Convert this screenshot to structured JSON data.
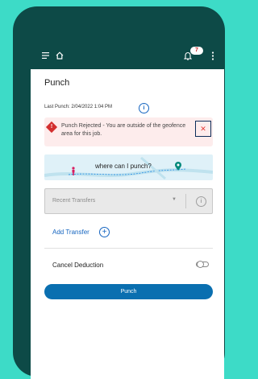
{
  "colors": {
    "background": "#3ddbc7",
    "device": "#0d4a47",
    "primary": "#0a6fb0",
    "link": "#1565c0",
    "alert_bg": "#fdecec",
    "alert_icon": "#d32f2f"
  },
  "header": {
    "menu_icon": "hamburger-menu-icon",
    "home_icon": "home-icon",
    "notification_icon": "bell-icon",
    "notification_count": "7",
    "more_icon": "kebab-menu-icon"
  },
  "page": {
    "title": "Punch",
    "last_punch": "Last Punch: 2/04/2022 1:04 PM",
    "last_punch_info_icon": "info-icon"
  },
  "alert": {
    "icon": "warning-diamond-icon",
    "message": "Punch Rejected - You are outside of the geofence area for this job.",
    "close_icon": "close-icon"
  },
  "map": {
    "label": "where can I punch?",
    "person_icon": "person-icon",
    "pin_icon": "location-pin-icon"
  },
  "transfers": {
    "select_label": "Recent Transfers",
    "chevron_icon": "chevron-down-icon",
    "info_icon": "info-icon",
    "add_label": "Add Transfer",
    "add_icon": "plus-circle-icon"
  },
  "cancel_deduction": {
    "label": "Cancel Deduction",
    "enabled": false
  },
  "actions": {
    "punch_label": "Punch"
  }
}
